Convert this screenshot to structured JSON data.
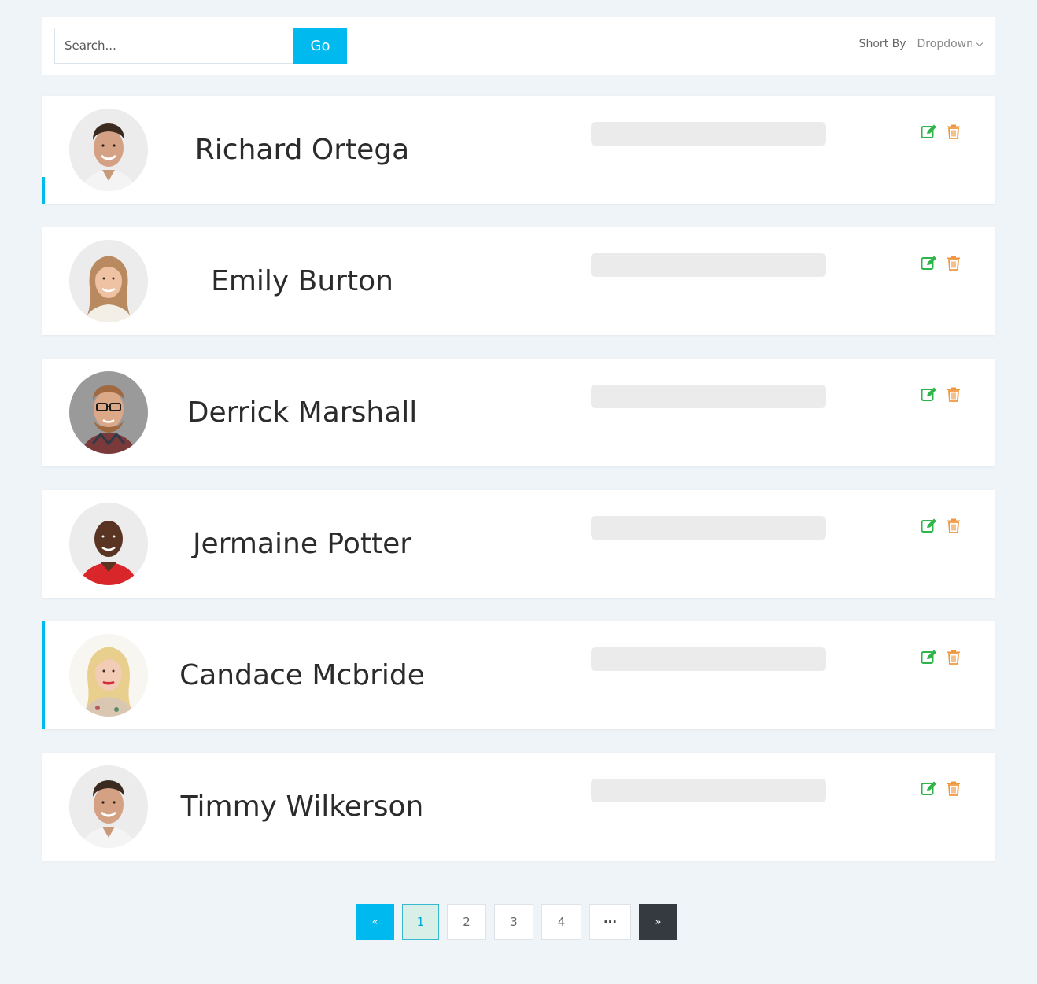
{
  "search": {
    "placeholder": "Search...",
    "go_label": "Go"
  },
  "sort": {
    "label": "Short By",
    "dropdown_label": "Dropdown"
  },
  "people": [
    {
      "name": "Richard Ortega",
      "avatar": "man-smiling"
    },
    {
      "name": "Emily Burton",
      "avatar": "woman-smiling"
    },
    {
      "name": "Derrick Marshall",
      "avatar": "man-glasses-beard"
    },
    {
      "name": "Jermaine Potter",
      "avatar": "man-red-shirt"
    },
    {
      "name": "Candace Mcbride",
      "avatar": "woman-blonde"
    },
    {
      "name": "Timmy Wilkerson",
      "avatar": "man-smiling"
    }
  ],
  "icons": {
    "edit": "edit-icon",
    "delete": "trash-icon"
  },
  "colors": {
    "accent": "#00b9ee",
    "edit": "#2db54a",
    "delete": "#f0963c",
    "next_button": "#343a40"
  },
  "pagination": {
    "prev": "«",
    "pages": [
      "1",
      "2",
      "3",
      "4"
    ],
    "ellipsis": "···",
    "next": "»",
    "current": "1"
  }
}
